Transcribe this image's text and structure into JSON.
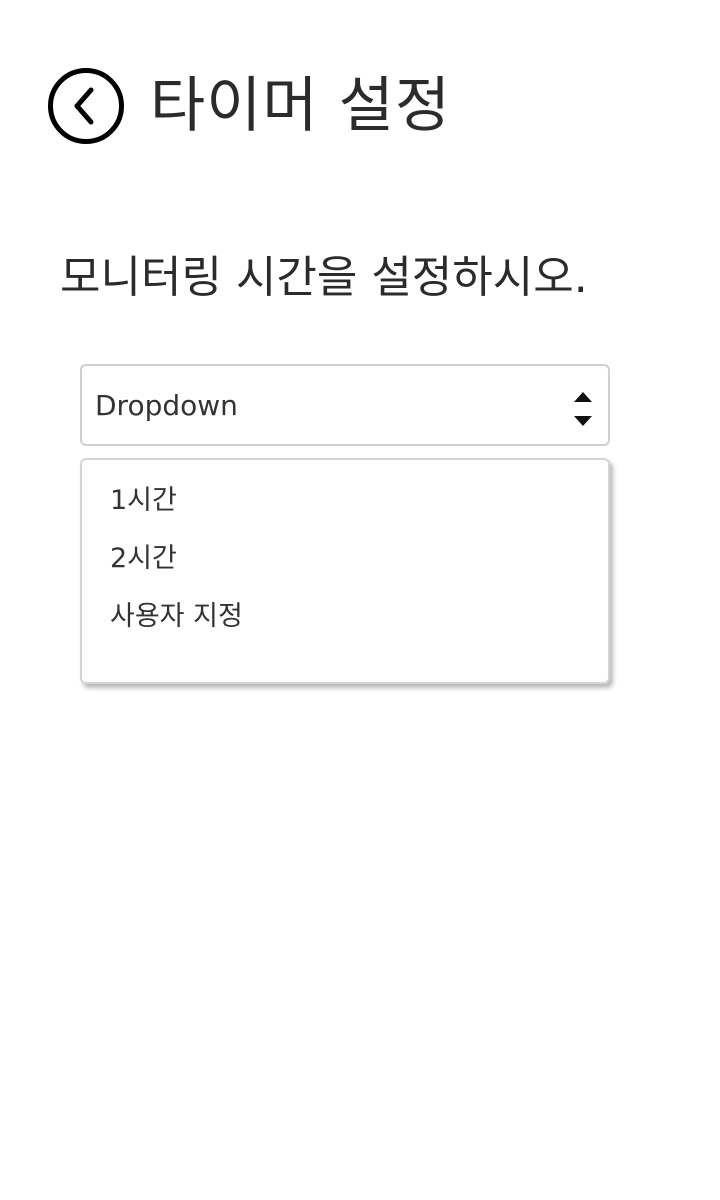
{
  "header": {
    "back_icon": "chevron-left-circle-icon",
    "title": "타이머 설정"
  },
  "prompt": "모니터링 시간을 설정하시오.",
  "dropdown": {
    "selected_label": "Dropdown",
    "arrows_icon": "sort-up-down-icon",
    "options": [
      {
        "label": "1시간"
      },
      {
        "label": "2시간"
      },
      {
        "label": "사용자 지정"
      }
    ]
  }
}
